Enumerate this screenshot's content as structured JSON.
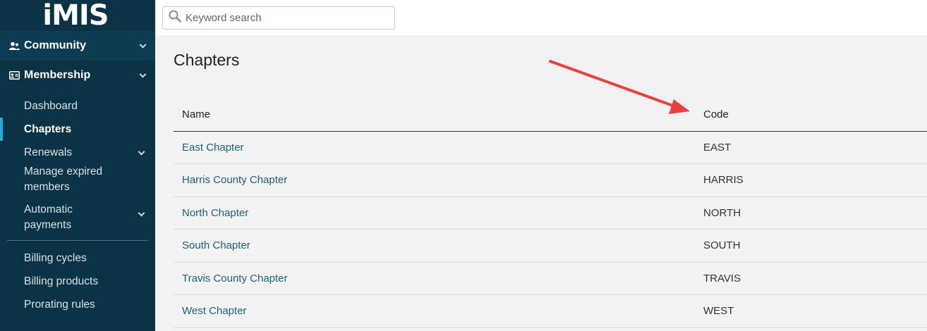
{
  "sidebar": {
    "logo": "iMIS",
    "sections": [
      {
        "label": "Community",
        "icon": "people-icon"
      },
      {
        "label": "Membership",
        "icon": "id-card-icon"
      }
    ],
    "items": [
      {
        "label": "Dashboard",
        "active": false,
        "expandable": false
      },
      {
        "label": "Chapters",
        "active": true,
        "expandable": false
      },
      {
        "label": "Renewals",
        "active": false,
        "expandable": true
      },
      {
        "label": "Manage expired members",
        "active": false,
        "expandable": false
      },
      {
        "label": "Automatic payments",
        "active": false,
        "expandable": true
      },
      {
        "label": "Billing cycles",
        "active": false,
        "expandable": false
      },
      {
        "label": "Billing products",
        "active": false,
        "expandable": false
      },
      {
        "label": "Prorating rules",
        "active": false,
        "expandable": false
      }
    ]
  },
  "search": {
    "placeholder": "Keyword search",
    "value": ""
  },
  "main": {
    "title": "Chapters",
    "table": {
      "columns": [
        "Name",
        "Code"
      ],
      "rows": [
        {
          "name": "East Chapter",
          "code": "EAST"
        },
        {
          "name": "Harris County Chapter",
          "code": "HARRIS"
        },
        {
          "name": "North Chapter",
          "code": "NORTH"
        },
        {
          "name": "South Chapter",
          "code": "SOUTH"
        },
        {
          "name": "Travis County Chapter",
          "code": "TRAVIS"
        },
        {
          "name": "West Chapter",
          "code": "WEST"
        }
      ]
    }
  },
  "colors": {
    "sidebar_bg": "#0b3346",
    "active_indicator": "#2aa8d8",
    "link": "#1d5f7a",
    "annotation_arrow": "#e8413f"
  }
}
